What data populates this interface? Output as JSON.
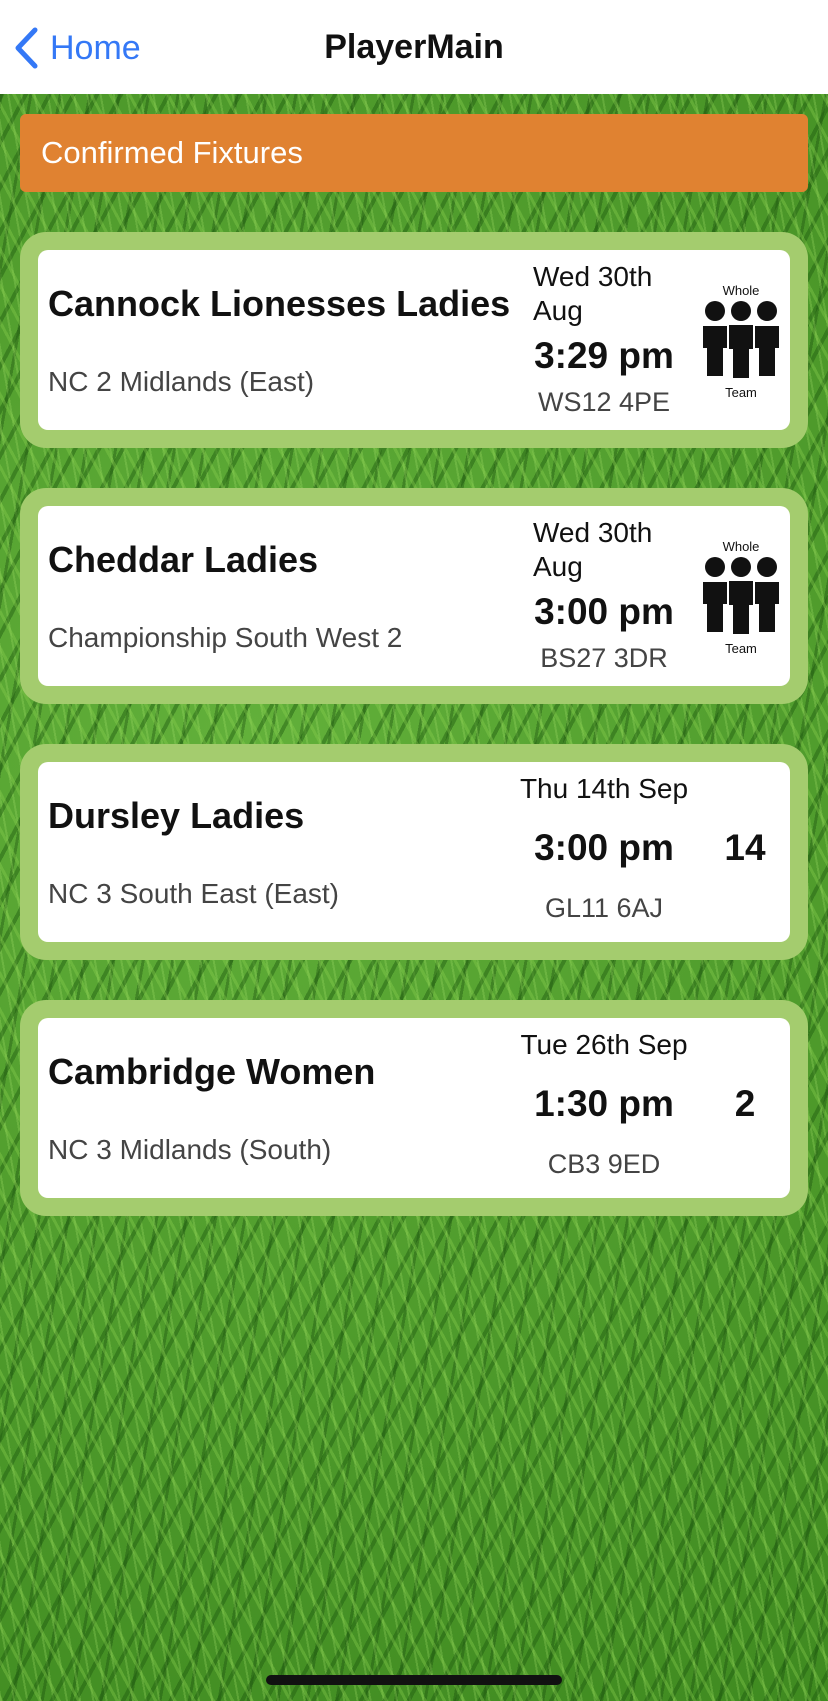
{
  "nav": {
    "back_label": "Home",
    "title": "PlayerMain"
  },
  "section": {
    "title": "Confirmed Fixtures"
  },
  "fixtures": [
    {
      "team": "Cannock Lionesses Ladies",
      "league": "NC 2 Midlands (East)",
      "date_line1": "Wed 30th",
      "date_line2": "Aug",
      "time": "3:29 pm",
      "postcode": "WS12 4PE",
      "icon_top": "Whole",
      "icon_bottom": "Team"
    },
    {
      "team": "Cheddar Ladies",
      "league": "Championship South West 2",
      "date_line1": "Wed 30th",
      "date_line2": "Aug",
      "time": "3:00 pm",
      "postcode": "BS27 3DR",
      "icon_top": "Whole",
      "icon_bottom": "Team"
    },
    {
      "team": "Dursley Ladies",
      "league": "NC 3 South East (East)",
      "date": "Thu 14th Sep",
      "time": "3:00 pm",
      "postcode": "GL11 6AJ",
      "count": "14"
    },
    {
      "team": "Cambridge Women",
      "league": "NC 3 Midlands (South)",
      "date": "Tue 26th Sep",
      "time": "1:30 pm",
      "postcode": "CB3 9ED",
      "count": "2"
    }
  ],
  "colors": {
    "accent": "#3478f6",
    "header_orange": "#e08231",
    "card_border": "#a4cc6e",
    "grass": "#4e9a2a"
  }
}
